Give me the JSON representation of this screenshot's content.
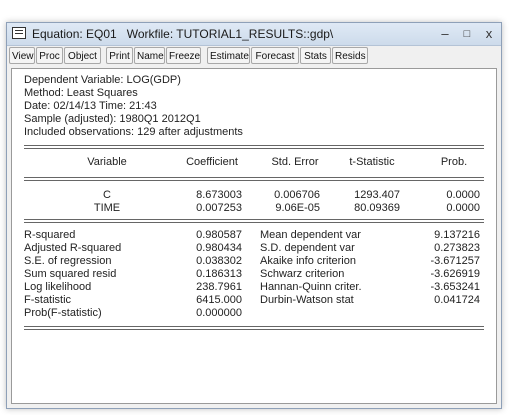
{
  "window": {
    "title_equation": "Equation: EQ01",
    "title_workfile": "Workfile: TUTORIAL1_RESULTS::gdp\\",
    "minimize_label": "–",
    "maximize_label": "□",
    "close_label": "x"
  },
  "toolbar": [
    "View",
    "Proc",
    "Object",
    "Print",
    "Name",
    "Freeze",
    "Estimate",
    "Forecast",
    "Stats",
    "Resids"
  ],
  "header": [
    "Dependent Variable: LOG(GDP)",
    "Method: Least Squares",
    "Date: 02/14/13   Time: 21:43",
    "Sample (adjusted): 1980Q1 2012Q1",
    "Included observations: 129 after adjustments"
  ],
  "coef_table": {
    "columns": [
      "Variable",
      "Coefficient",
      "Std. Error",
      "t-Statistic",
      "Prob."
    ],
    "rows": [
      [
        "C",
        "8.673003",
        "0.006706",
        "1293.407",
        "0.0000"
      ],
      [
        "TIME",
        "0.007253",
        "9.06E-05",
        "80.09369",
        "0.0000"
      ]
    ]
  },
  "stats": {
    "left": [
      [
        "R-squared",
        "0.980587"
      ],
      [
        "Adjusted R-squared",
        "0.980434"
      ],
      [
        "S.E. of regression",
        "0.038302"
      ],
      [
        "Sum squared resid",
        "0.186313"
      ],
      [
        "Log likelihood",
        "238.7961"
      ],
      [
        "F-statistic",
        "6415.000"
      ],
      [
        "Prob(F-statistic)",
        "0.000000"
      ]
    ],
    "right": [
      [
        "Mean dependent var",
        "9.137216"
      ],
      [
        "S.D. dependent var",
        "0.273823"
      ],
      [
        "Akaike info criterion",
        "-3.671257"
      ],
      [
        "Schwarz criterion",
        "-3.626919"
      ],
      [
        "Hannan-Quinn criter.",
        "-3.653241"
      ],
      [
        "Durbin-Watson stat",
        "0.041724"
      ]
    ]
  }
}
